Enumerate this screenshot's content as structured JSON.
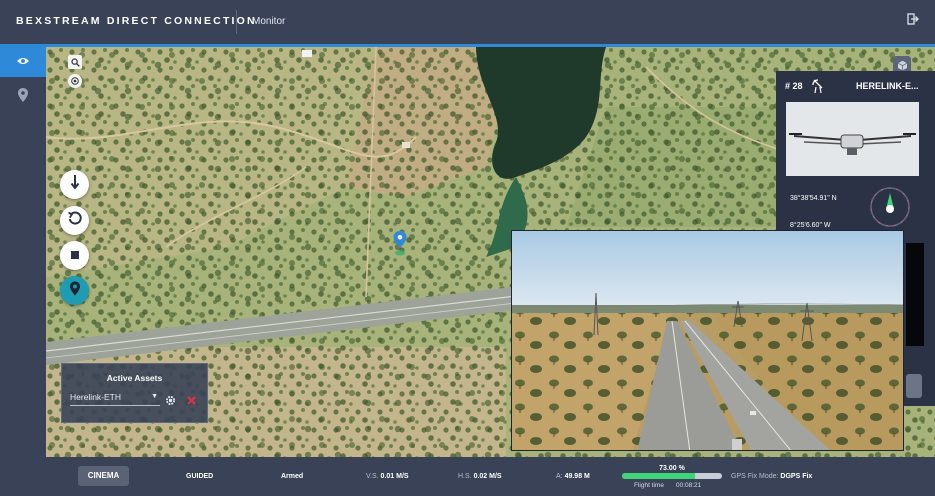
{
  "header": {
    "brand": "BEXSTREAM DIRECT CONNECTION",
    "page": "Monitor",
    "logout_icon": "logout-icon"
  },
  "nav": {
    "items": [
      {
        "name": "monitor",
        "icon": "eye-icon",
        "active": true
      },
      {
        "name": "map",
        "icon": "location-pin-icon",
        "active": false
      }
    ]
  },
  "map_controls": {
    "tools": [
      "search-icon",
      "locate-icon"
    ],
    "commands": [
      "land-icon",
      "return-to-launch-icon",
      "stop-icon",
      "waypoint-icon"
    ]
  },
  "assets_panel": {
    "title": "Active Assets",
    "selected": "Herelink-ETH"
  },
  "vehicle": {
    "id": "# 28",
    "name": "HERELINK-E...",
    "latitude": "38°38'54.91\" N",
    "longitude": "8°25'6.60\" W"
  },
  "status": {
    "mode_button": "CINEMA",
    "flight_mode": "GUIDED",
    "arm_state": "Armed",
    "vs_label": "V.S.",
    "vs_value": "0.01 M/S",
    "hs_label": "H.S.",
    "hs_value": "0.02 M/S",
    "alt_label": "A:",
    "alt_value": "49.98 M",
    "battery_percent": 73,
    "battery_label": "73.00 %",
    "flight_time_label": "Flight time",
    "flight_time_value": "00:08:21",
    "gps_label": "GPS Fix Mode:",
    "gps_value": "DGPS Fix"
  },
  "colors": {
    "accent": "#2e8ad8",
    "panel": "#3a4257",
    "battery": "#3fd47a",
    "waypoint_button": "#1d9cb2",
    "remove": "#e0314a"
  }
}
